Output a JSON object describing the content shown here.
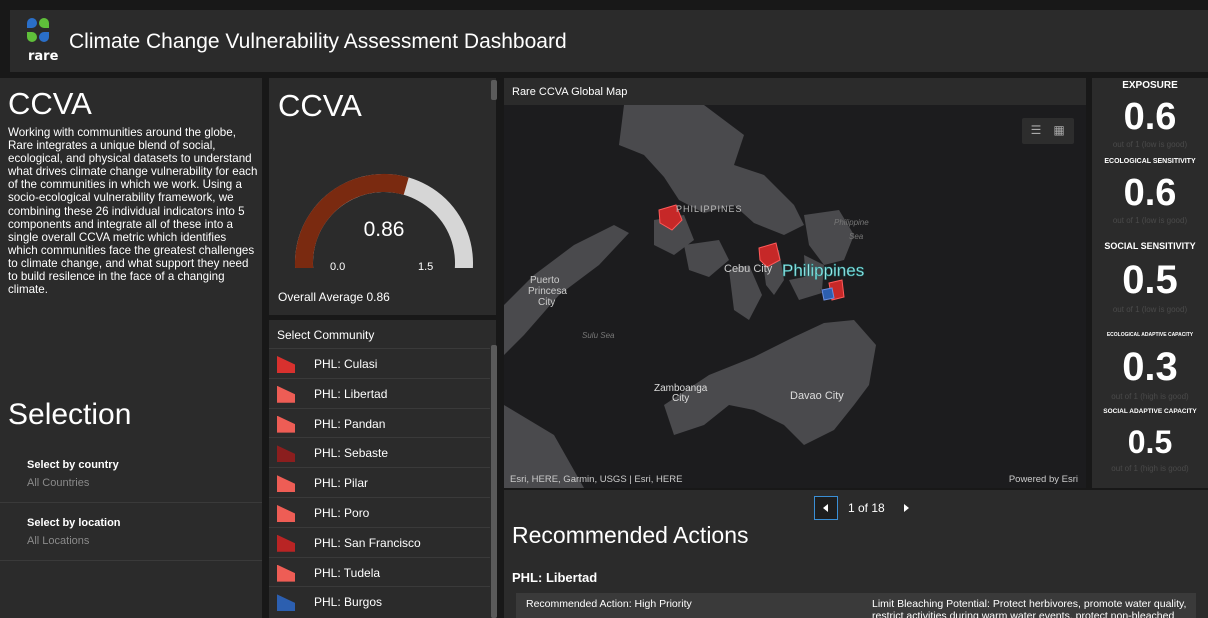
{
  "header": {
    "logo_text": "rare",
    "title": "Climate Change Vulnerability Assessment Dashboard"
  },
  "left_panel": {
    "heading": "CCVA",
    "description": "Working with communities around the globe, Rare integrates a unique blend of social, ecological, and physical datasets to understand what drives climate change vulnerability for each of the communities in which we work. Using a socio-ecological vulnerability framework, we combining these 26 individual indicators into 5 components and integrate all of these into a single overall CCVA metric which identifies which communities face the greatest challenges to climate change, and what support they need to build resilence in the face of a changing climate.",
    "selection_heading": "Selection",
    "selectors": [
      {
        "label": "Select by country",
        "value": "All Countries"
      },
      {
        "label": "Select by location",
        "value": "All Locations"
      }
    ]
  },
  "gauge": {
    "title": "CCVA",
    "value": "0.86",
    "value_num": 0.86,
    "min": "0.0",
    "max": "1.5",
    "min_num": 0.0,
    "max_num": 1.5,
    "footer": "Overall Average 0.86",
    "fill_color": "#7a2a10",
    "track_color": "#d6d6d6"
  },
  "community_list": {
    "heading": "Select Community",
    "items": [
      {
        "label": "PHL: Culasi",
        "color": "#d8312e"
      },
      {
        "label": "PHL: Libertad",
        "color": "#ee5d55"
      },
      {
        "label": "PHL: Pandan",
        "color": "#ee5d55"
      },
      {
        "label": "PHL: Sebaste",
        "color": "#8b1e1e"
      },
      {
        "label": "PHL: Pilar",
        "color": "#ee5d55"
      },
      {
        "label": "PHL: Poro",
        "color": "#ee5d55"
      },
      {
        "label": "PHL: San Francisco",
        "color": "#b92424"
      },
      {
        "label": "PHL: Tudela",
        "color": "#ee5d55"
      },
      {
        "label": "PHL: Burgos",
        "color": "#2c5fb0"
      }
    ]
  },
  "map": {
    "title": "Rare CCVA Global Map",
    "labels": {
      "philippines_small": "PHILIPPINES",
      "philippine_sea_1": "Philippine",
      "philippine_sea_2": "Sea",
      "cebu": "Cebu City",
      "philippines_big": "Philippines",
      "puerto_1": "Puerto",
      "puerto_2": "Princesa",
      "puerto_3": "City",
      "sulu": "Sulu Sea",
      "zamboanga_1": "Zamboanga",
      "zamboanga_2": "City",
      "davao": "Davao City"
    },
    "attribution": "Esri, HERE, Garmin, USGS | Esri, HERE",
    "powered": "Powered by Esri",
    "tools": [
      "legend-icon",
      "basemap-icon"
    ]
  },
  "actions": {
    "pager_text": "1 of 18",
    "heading": "Recommended Actions",
    "community": "PHL: Libertad",
    "row": {
      "col1": "Recommended Action: High Priority",
      "col2": "Limit Bleaching Potential: Protect herbivores, promote water quality, restrict activities during warm water events, protect non-bleached"
    }
  },
  "metrics": [
    {
      "label": "EXPOSURE",
      "value": "0.6",
      "note": "out of 1 (low is good)"
    },
    {
      "label": "ECOLOGICAL SENSITIVITY",
      "value": "0.6",
      "note": "out of 1 (low is good)"
    },
    {
      "label": "SOCIAL SENSITIVITY",
      "value": "0.5",
      "note": "out of 1 (low is good)"
    },
    {
      "label": "ECOLOGICAL ADAPTIVE CAPACITY",
      "value": "0.3",
      "note": "out of 1 (high is good)"
    },
    {
      "label": "SOCIAL ADAPTIVE CAPACITY",
      "value": "0.5",
      "note": "out of 1 (high is good)"
    }
  ]
}
